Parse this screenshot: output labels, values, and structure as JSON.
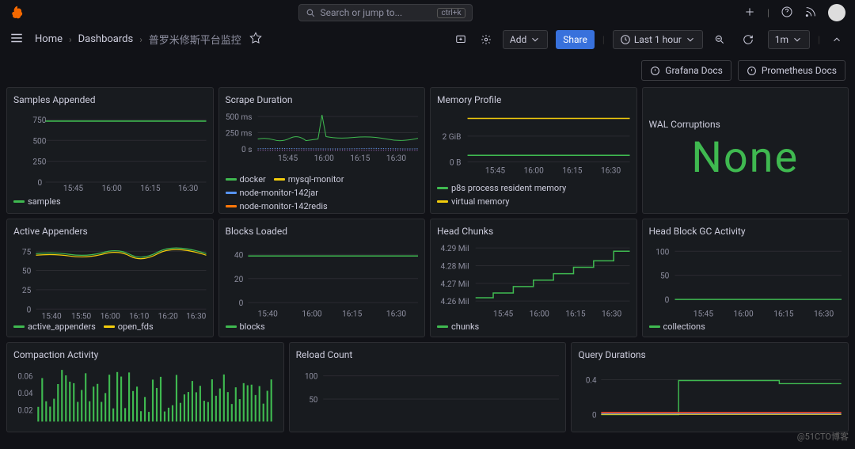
{
  "search": {
    "placeholder": "Search or jump to...",
    "kbd": "ctrl+k"
  },
  "breadcrumb": {
    "home": "Home",
    "dashboards": "Dashboards",
    "current": "普罗米修斯平台监控"
  },
  "toolbar": {
    "add": "Add",
    "share": "Share",
    "time": "Last 1 hour",
    "refresh": "1m"
  },
  "docs": {
    "grafana": "Grafana Docs",
    "prometheus": "Prometheus Docs"
  },
  "watermark": "@51CTO博客",
  "panels": {
    "samples": {
      "title": "Samples Appended",
      "legend": [
        "samples"
      ],
      "yticks": [
        "0",
        "250",
        "500",
        "750"
      ],
      "xticks": [
        "15:45",
        "16:00",
        "16:15",
        "16:30"
      ]
    },
    "scrape": {
      "title": "Scrape Duration",
      "legend": [
        "docker",
        "mysql-monitor",
        "node-monitor-142jar",
        "node-monitor-142redis"
      ],
      "yticks": [
        "0 s",
        "250 ms",
        "500 ms"
      ],
      "xticks": [
        "15:45",
        "16:00",
        "16:15",
        "16:30"
      ]
    },
    "memory": {
      "title": "Memory Profile",
      "legend": [
        "p8s process resident memory",
        "virtual memory"
      ],
      "yticks": [
        "0 B",
        "2 GiB"
      ],
      "xticks": [
        "15:45",
        "16:00",
        "16:15",
        "16:30"
      ]
    },
    "wal": {
      "title": "WAL Corruptions",
      "value": "None"
    },
    "appenders": {
      "title": "Active Appenders",
      "legend": [
        "active_appenders",
        "open_fds"
      ],
      "yticks": [
        "0",
        "25",
        "50",
        "75"
      ],
      "xticks": [
        "15:40",
        "15:50",
        "16:00",
        "16:10",
        "16:20",
        "16:30"
      ]
    },
    "blocks": {
      "title": "Blocks Loaded",
      "legend": [
        "blocks"
      ],
      "yticks": [
        "0",
        "20",
        "40"
      ],
      "xticks": [
        "15:40",
        "16:00",
        "16:15",
        "16:30"
      ]
    },
    "head": {
      "title": "Head Chunks",
      "legend": [
        "chunks"
      ],
      "yticks": [
        "4.26 Mil",
        "4.27 Mil",
        "4.28 Mil",
        "4.29 Mil"
      ],
      "xticks": [
        "15:45",
        "16:00",
        "16:15",
        "16:30"
      ]
    },
    "gc": {
      "title": "Head Block GC Activity",
      "legend": [
        "collections"
      ],
      "yticks": [
        "0",
        "50",
        "100"
      ],
      "xticks": [
        "15:45",
        "16:00",
        "16:15",
        "16:30"
      ]
    },
    "compaction": {
      "title": "Compaction Activity",
      "yticks": [
        "0.02",
        "0.04",
        "0.06"
      ]
    },
    "reload": {
      "title": "Reload Count",
      "yticks": [
        "50",
        "100"
      ]
    },
    "query": {
      "title": "Query Durations",
      "yticks": [
        "0",
        "0.4"
      ]
    }
  },
  "chart_data": [
    {
      "type": "line",
      "title": "Samples Appended",
      "x_range": [
        "15:30",
        "16:30"
      ],
      "ylim": [
        0,
        780
      ],
      "series": [
        {
          "name": "samples",
          "values_approx": 770
        }
      ]
    },
    {
      "type": "line",
      "title": "Scrape Duration",
      "x_range": [
        "15:30",
        "16:30"
      ],
      "ylim": [
        "0 s",
        "500 ms"
      ],
      "series": [
        {
          "name": "docker"
        },
        {
          "name": "mysql-monitor"
        },
        {
          "name": "node-monitor-142jar"
        },
        {
          "name": "node-monitor-142redis"
        }
      ],
      "note": "green series ~180ms with spike to ~500ms near 16:05; others near 0-20ms"
    },
    {
      "type": "line",
      "title": "Memory Profile",
      "x_range": [
        "15:30",
        "16:30"
      ],
      "series": [
        {
          "name": "virtual memory",
          "approx": "~3 GiB flat"
        },
        {
          "name": "p8s process resident memory",
          "approx": "~0.4 GiB flat"
        }
      ]
    },
    {
      "type": "singlestat",
      "title": "WAL Corruptions",
      "value": "None"
    },
    {
      "type": "line",
      "title": "Active Appenders",
      "x_range": [
        "15:35",
        "16:35"
      ],
      "ylim": [
        0,
        80
      ],
      "series": [
        {
          "name": "active_appenders",
          "approx": 75
        },
        {
          "name": "open_fds",
          "approx": 73
        }
      ]
    },
    {
      "type": "line",
      "title": "Blocks Loaded",
      "x_range": [
        "15:35",
        "16:30"
      ],
      "ylim": [
        0,
        45
      ],
      "series": [
        {
          "name": "blocks",
          "approx": 40
        }
      ]
    },
    {
      "type": "line",
      "title": "Head Chunks",
      "x_range": [
        "15:30",
        "16:30"
      ],
      "ylim": [
        4260000,
        4290000
      ],
      "series": [
        {
          "name": "chunks",
          "shape": "stepwise increase from ~4.264M to ~4.29M"
        }
      ]
    },
    {
      "type": "line",
      "title": "Head Block GC Activity",
      "x_range": [
        "15:30",
        "16:30"
      ],
      "ylim": [
        0,
        100
      ],
      "series": [
        {
          "name": "collections",
          "approx": 0
        }
      ]
    },
    {
      "type": "bar",
      "title": "Compaction Activity",
      "ylim": [
        0,
        0.07
      ],
      "note": "dense vertical striped bars 0.01-0.07"
    },
    {
      "type": "line",
      "title": "Reload Count",
      "ylim": [
        0,
        110
      ]
    },
    {
      "type": "line",
      "title": "Query Durations",
      "ylim": [
        0,
        0.5
      ],
      "note": "green step to ~0.45; multi-colored baselines near 0"
    }
  ]
}
